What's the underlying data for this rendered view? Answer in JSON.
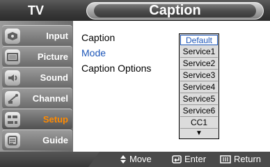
{
  "header": {
    "tv_label": "TV",
    "title": "Caption"
  },
  "sidebar": {
    "items": [
      {
        "label": "Input",
        "icon": "input-icon"
      },
      {
        "label": "Picture",
        "icon": "picture-icon"
      },
      {
        "label": "Sound",
        "icon": "sound-icon"
      },
      {
        "label": "Channel",
        "icon": "channel-icon"
      },
      {
        "label": "Setup",
        "icon": "setup-icon",
        "active": true
      },
      {
        "label": "Guide",
        "icon": "guide-icon"
      }
    ]
  },
  "menu": {
    "items": [
      {
        "label": "Caption"
      },
      {
        "label": "Mode",
        "selected": true
      },
      {
        "label": "Caption Options"
      }
    ]
  },
  "dropdown": {
    "options": [
      "Default",
      "Service1",
      "Service2",
      "Service3",
      "Service4",
      "Service5",
      "Service6",
      "CC1"
    ],
    "selected_index": 0,
    "more_indicator": "▼"
  },
  "bottom": {
    "move_label": "Move",
    "enter_label": "Enter",
    "return_label": "Return"
  },
  "colors": {
    "accent": "#1d56b8",
    "active_text": "#ff8a00"
  }
}
